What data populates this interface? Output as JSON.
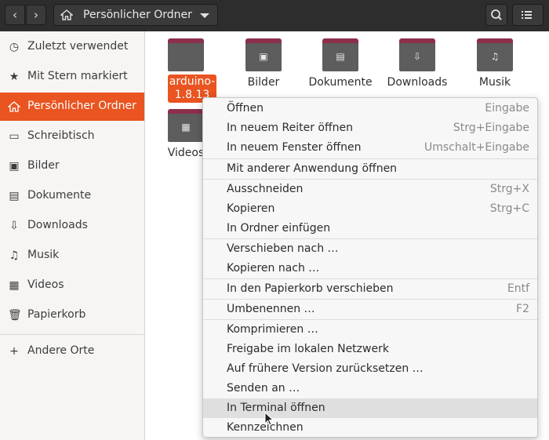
{
  "header": {
    "location": "Persönlicher Ordner",
    "icons": [
      "back-icon",
      "forward-icon",
      "home-icon",
      "search-icon",
      "list-view-icon"
    ]
  },
  "sidebar": {
    "items": [
      {
        "label": "Zuletzt verwendet",
        "icon": "recent-icon"
      },
      {
        "label": "Mit Stern markiert",
        "icon": "star-icon"
      },
      {
        "label": "Persönlicher Ordner",
        "icon": "home-icon",
        "active": true
      },
      {
        "label": "Schreibtisch",
        "icon": "desktop-icon"
      },
      {
        "label": "Bilder",
        "icon": "pictures-icon"
      },
      {
        "label": "Dokumente",
        "icon": "documents-icon"
      },
      {
        "label": "Downloads",
        "icon": "downloads-icon"
      },
      {
        "label": "Musik",
        "icon": "music-icon"
      },
      {
        "label": "Videos",
        "icon": "videos-icon"
      },
      {
        "label": "Papierkorb",
        "icon": "trash-icon"
      },
      {
        "label": "Andere Orte",
        "icon": "plus-icon"
      }
    ]
  },
  "files": [
    {
      "label": "arduino-1.8.13",
      "selected": true
    },
    {
      "label": "Bilder"
    },
    {
      "label": "Dokumente"
    },
    {
      "label": "Downloads"
    },
    {
      "label": "Musik"
    },
    {
      "label": "Videos"
    }
  ],
  "context_menu": {
    "items": [
      {
        "label": "Öffnen",
        "accel": "Eingabe"
      },
      {
        "label": "In neuem Reiter öffnen",
        "accel": "Strg+Eingabe"
      },
      {
        "label": "In neuem Fenster öffnen",
        "accel": "Umschalt+Eingabe"
      },
      {
        "label": "Mit anderer Anwendung öffnen",
        "accel": ""
      },
      {
        "label": "Ausschneiden",
        "accel": "Strg+X"
      },
      {
        "label": "Kopieren",
        "accel": "Strg+C"
      },
      {
        "label": "In Ordner einfügen",
        "accel": ""
      },
      {
        "label": "Verschieben nach …",
        "accel": ""
      },
      {
        "label": "Kopieren nach …",
        "accel": ""
      },
      {
        "label": "In den Papierkorb verschieben",
        "accel": "Entf"
      },
      {
        "label": "Umbenennen …",
        "accel": "F2"
      },
      {
        "label": "Komprimieren …",
        "accel": ""
      },
      {
        "label": "Freigabe im lokalen Netzwerk",
        "accel": ""
      },
      {
        "label": "Auf frühere Version zurücksetzen …",
        "accel": ""
      },
      {
        "label": "Senden an …",
        "accel": ""
      },
      {
        "label": "In Terminal öffnen",
        "accel": "",
        "hover": true
      },
      {
        "label": "Kennzeichnen",
        "accel": ""
      }
    ]
  },
  "colors": {
    "accent": "#e95420",
    "headerbar": "#2d2d2d",
    "folder_tab": "#8c2f4a"
  }
}
